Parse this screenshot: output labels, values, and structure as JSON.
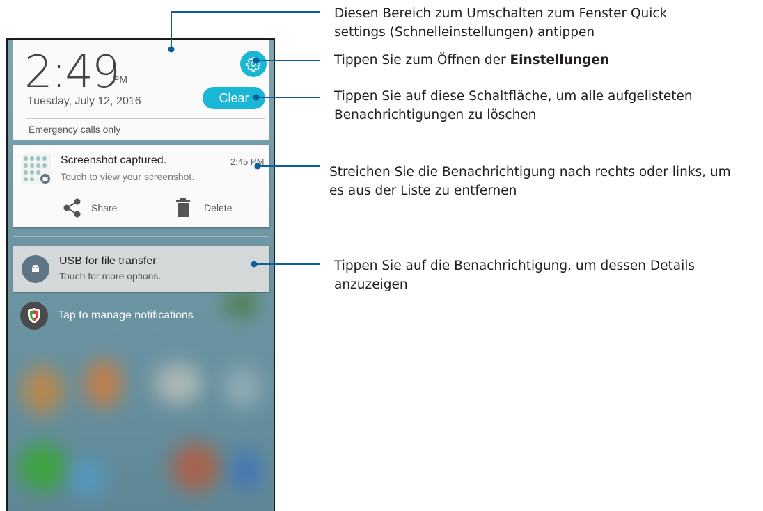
{
  "header": {
    "time": "2:49",
    "ampm": "PM",
    "date": "Tuesday, July 12, 2016",
    "clear_label": "Clear",
    "emergency": "Emergency calls only"
  },
  "notifications": [
    {
      "title": "Screenshot captured.",
      "time": "2:45 PM",
      "subtitle": "Touch to view your screenshot.",
      "actions": [
        {
          "label": "Share",
          "icon": "share-icon"
        },
        {
          "label": "Delete",
          "icon": "trash-icon"
        }
      ]
    },
    {
      "title": "USB for file transfer",
      "subtitle": "Touch for more options.",
      "icon": "android-icon"
    }
  ],
  "manage": {
    "label": "Tap to manage notifications",
    "icon": "shield-icon"
  },
  "annotations": {
    "quick_settings_line1": "Diesen Bereich zum Umschalten zum Fenster Quick",
    "quick_settings_line2": "settings (Schnelleinstellungen) antippen",
    "settings_prefix": "Tippen Sie zum Öffnen der ",
    "settings_bold": "Einstellungen",
    "clear_line1": "Tippen Sie auf diese Schaltfläche, um alle aufgelisteten",
    "clear_line2": "Benachrichtigungen zu löschen",
    "swipe_line1": "Streichen Sie die Benachrichtigung nach rechts oder links, um",
    "swipe_line2": "es aus der Liste zu entfernen",
    "details_line1": "Tippen Sie auf die Benachrichtigung, um dessen Details",
    "details_line2": "anzuzeigen"
  },
  "colors": {
    "accent": "#1ab6d5",
    "callout_line": "#0b5d9c"
  }
}
